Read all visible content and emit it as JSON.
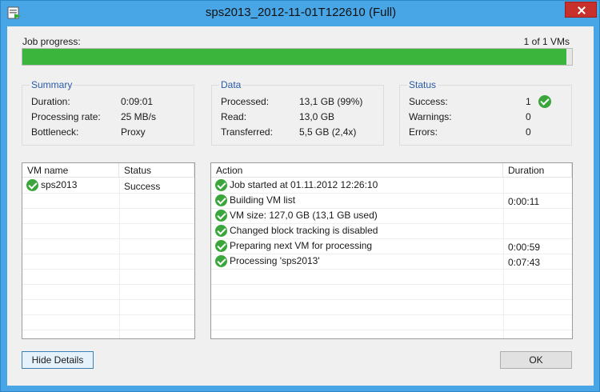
{
  "window": {
    "title": "sps2013_2012-11-01T122610 (Full)"
  },
  "progress": {
    "label": "Job progress:",
    "count": "1 of 1 VMs",
    "fraction": 0.99
  },
  "summary": {
    "title": "Summary",
    "rows": [
      {
        "label": "Duration:",
        "value": "0:09:01"
      },
      {
        "label": "Processing rate:",
        "value": "25 MB/s"
      },
      {
        "label": "Bottleneck:",
        "value": "Proxy"
      }
    ]
  },
  "data": {
    "title": "Data",
    "rows": [
      {
        "label": "Processed:",
        "value": "13,1 GB (99%)"
      },
      {
        "label": "Read:",
        "value": "13,0 GB"
      },
      {
        "label": "Transferred:",
        "value": "5,5 GB (2,4x)"
      }
    ]
  },
  "status": {
    "title": "Status",
    "rows": [
      {
        "label": "Success:",
        "value": "1"
      },
      {
        "label": "Warnings:",
        "value": "0"
      },
      {
        "label": "Errors:",
        "value": "0"
      }
    ]
  },
  "vm_table": {
    "columns": [
      "VM name",
      "Status"
    ],
    "rows": [
      {
        "name": "sps2013",
        "status": "Success"
      }
    ]
  },
  "action_table": {
    "columns": [
      "Action",
      "Duration"
    ],
    "rows": [
      {
        "action": "Job started at 01.11.2012 12:26:10",
        "duration": ""
      },
      {
        "action": "Building VM list",
        "duration": "0:00:11"
      },
      {
        "action": "VM size: 127,0 GB (13,1 GB used)",
        "duration": ""
      },
      {
        "action": "Changed block tracking is disabled",
        "duration": ""
      },
      {
        "action": "Preparing next VM for processing",
        "duration": "0:00:59"
      },
      {
        "action": "Processing 'sps2013'",
        "duration": "0:07:43"
      }
    ]
  },
  "buttons": {
    "hide_details": "Hide Details",
    "ok": "OK"
  }
}
